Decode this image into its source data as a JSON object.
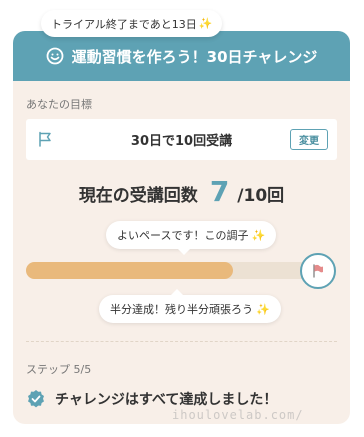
{
  "trial_badge": {
    "text": "トライアル終了まであと13日",
    "icon": "sparkles-icon"
  },
  "header": {
    "icon": "smile-icon",
    "title": "運動習慣を作ろう！30日チャレンジ"
  },
  "goal": {
    "label": "あなたの目標",
    "icon": "flag-icon",
    "text": "30日で10回受講",
    "change_button": "変更"
  },
  "count": {
    "label": "現在の受講回数",
    "value": "7",
    "total": "/10回"
  },
  "bubble_top": {
    "text": "よいペースです！この調子",
    "icon": "sparkles-icon"
  },
  "progress": {
    "value": 0.7,
    "goal_icon": "goal-flag-icon"
  },
  "bubble_bottom": {
    "text": "半分達成！残り半分頑張ろう",
    "icon": "sparkles-icon"
  },
  "step": {
    "label": "ステップ 5/5"
  },
  "completion": {
    "icon": "check-badge-icon",
    "text": "チャレンジはすべて達成しました！"
  },
  "watermark": "ihoulovelab.com/",
  "colors": {
    "accent": "#5ea2b4",
    "progress_fill": "#e9b97c",
    "progress_track": "#ece1d3",
    "card_bg": "#f8efe8",
    "flag_red": "#e58b8b"
  }
}
